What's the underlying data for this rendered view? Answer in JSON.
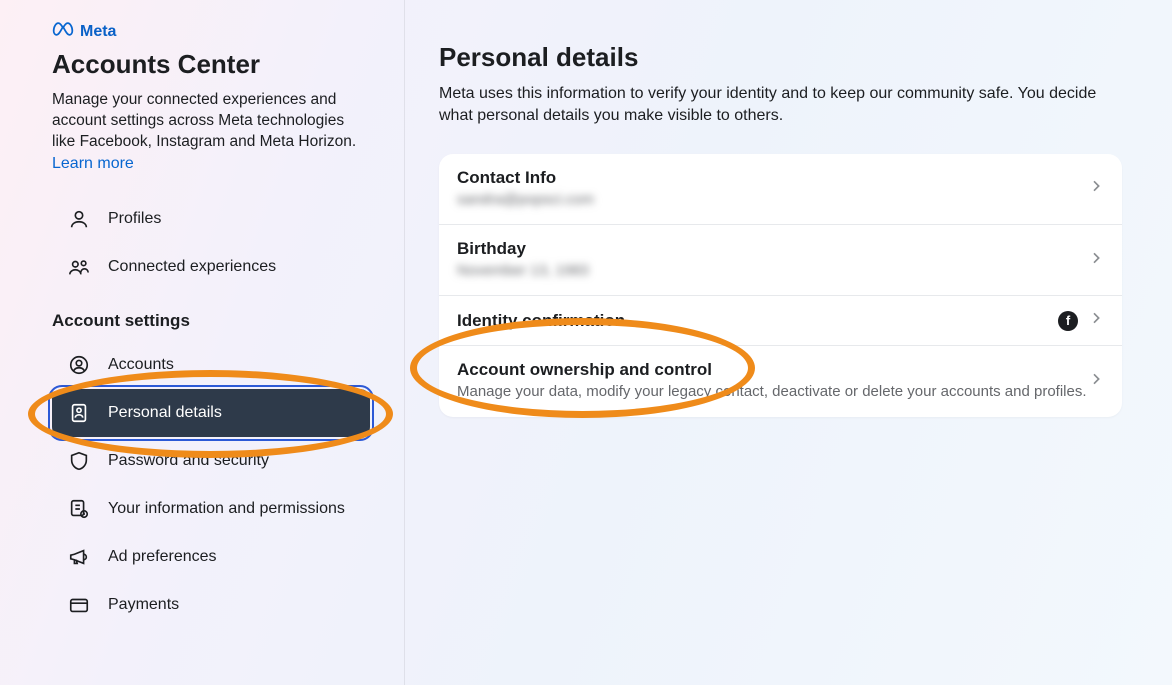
{
  "brand": {
    "name": "Meta"
  },
  "sidebar": {
    "title": "Accounts Center",
    "description": "Manage your connected experiences and account settings across Meta technologies like Facebook, Instagram and Meta Horizon.",
    "learn_more": "Learn more",
    "top_items": [
      {
        "label": "Profiles"
      },
      {
        "label": "Connected experiences"
      }
    ],
    "section_heading": "Account settings",
    "settings_items": [
      {
        "label": "Accounts"
      },
      {
        "label": "Personal details"
      },
      {
        "label": "Password and security"
      },
      {
        "label": "Your information and permissions"
      },
      {
        "label": "Ad preferences"
      },
      {
        "label": "Payments"
      }
    ]
  },
  "main": {
    "title": "Personal details",
    "description": "Meta uses this information to verify your identity and to keep our community safe. You decide what personal details you make visible to others.",
    "rows": {
      "contact": {
        "title": "Contact Info",
        "subtitle": "sandra@popsci.com"
      },
      "birthday": {
        "title": "Birthday",
        "subtitle": "November 13, 1983"
      },
      "identity": {
        "title": "Identity confirmation"
      },
      "ownership": {
        "title": "Account ownership and control",
        "subtitle": "Manage your data, modify your legacy contact, deactivate or delete your accounts and profiles."
      }
    }
  },
  "colors": {
    "annotation": "#ef8b1a",
    "link": "#0866d0",
    "active_nav_bg": "#2e3a4a"
  }
}
